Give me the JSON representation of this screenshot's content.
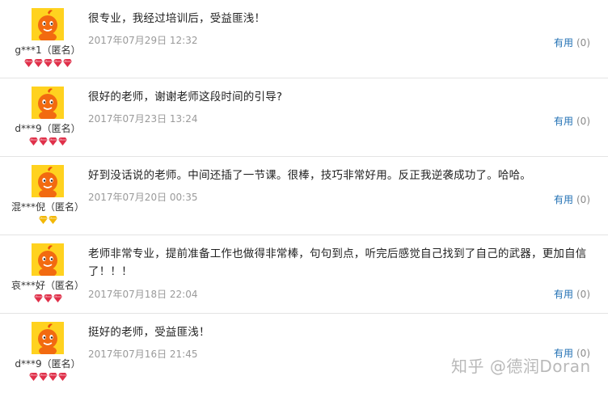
{
  "reviews": [
    {
      "user": "g***1（匿名）",
      "comment": "很专业，我经过培训后，受益匪浅！",
      "date": "2017年07月29日 12:32",
      "useful_label": "有用",
      "useful_count": "(0)",
      "gem_color": "red",
      "gem_count": 5
    },
    {
      "user": "d***9（匿名）",
      "comment": "很好的老师，谢谢老师这段时间的引导?",
      "date": "2017年07月23日 13:24",
      "useful_label": "有用",
      "useful_count": "(0)",
      "gem_color": "red",
      "gem_count": 4
    },
    {
      "user": "混***倪（匿名）",
      "comment": "好到没话说的老师。中间还插了一节课。很棒，技巧非常好用。反正我逆袭成功了。哈哈。",
      "date": "2017年07月20日 00:35",
      "useful_label": "有用",
      "useful_count": "(0)",
      "gem_color": "gold",
      "gem_count": 2
    },
    {
      "user": "哀***好（匿名）",
      "comment": "老师非常专业，提前准备工作也做得非常棒，句句到点，听完后感觉自己找到了自己的武器，更加自信了！！！",
      "date": "2017年07月18日 22:04",
      "useful_label": "有用",
      "useful_count": "(0)",
      "gem_color": "red",
      "gem_count": 3
    },
    {
      "user": "d***9（匿名）",
      "comment": "挺好的老师，受益匪浅！",
      "date": "2017年07月16日 21:45",
      "useful_label": "有用",
      "useful_count": "(0)",
      "gem_color": "red",
      "gem_count": 4
    }
  ],
  "watermark": "知乎 @德润Doran",
  "colors": {
    "red_gem": "#e0304a",
    "gold_gem": "#f2b705",
    "avatar_bg": "#ffd21f",
    "link": "#1f6fb3"
  }
}
